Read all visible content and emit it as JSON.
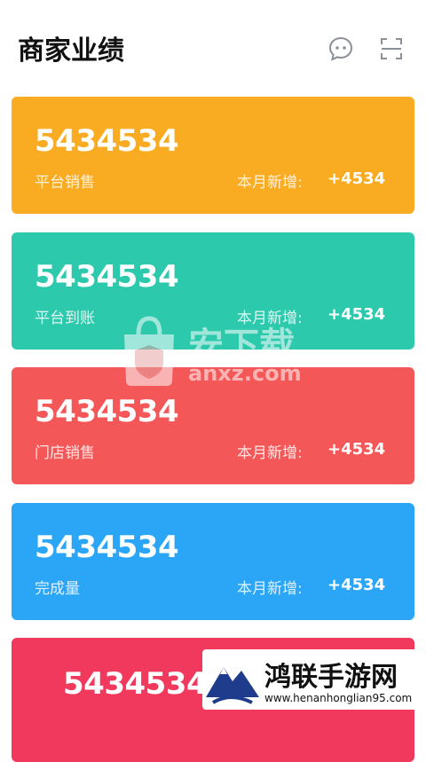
{
  "header": {
    "title": "商家业绩",
    "icons": [
      "chat-icon",
      "scan-icon"
    ]
  },
  "cards": [
    {
      "value": "5434534",
      "label": "平台销售",
      "delta_label": "本月新增:",
      "delta": "+4534",
      "color": "#F9AB21"
    },
    {
      "value": "5434534",
      "label": "平台到账",
      "delta_label": "本月新增:",
      "delta": "+4534",
      "color": "#2CC9AD"
    },
    {
      "value": "5434534",
      "label": "门店销售",
      "delta_label": "本月新增:",
      "delta": "+4534",
      "color": "#F45757"
    },
    {
      "value": "5434534",
      "label": "完成量",
      "delta_label": "本月新增:",
      "delta": "+4534",
      "color": "#2BA5F6"
    },
    {
      "value": "5434534",
      "color": "#F0395D"
    }
  ],
  "watermark": {
    "text": "安下载",
    "sub": "anxz.com"
  },
  "promo": {
    "title": "鸿联手游网",
    "url": "www.henanhonglian95.com"
  }
}
